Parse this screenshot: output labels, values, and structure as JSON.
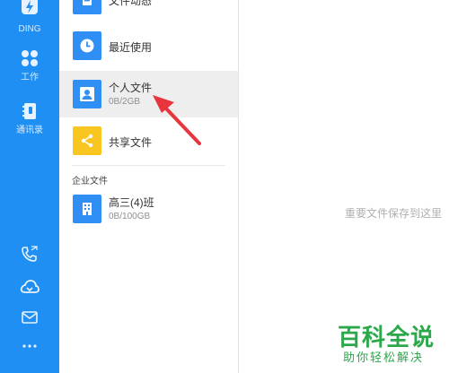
{
  "sidebar": {
    "items": [
      {
        "label": "DING",
        "icon": "ding-bolt-icon"
      },
      {
        "label": "工作",
        "icon": "work-grid-icon"
      },
      {
        "label": "通讯录",
        "icon": "contacts-book-icon"
      }
    ],
    "bottom_icons": [
      "phone-icon",
      "cloud-icon",
      "mail-icon",
      "more-dots-icon"
    ]
  },
  "files": {
    "top_partial": {
      "label": "文件动态"
    },
    "items": [
      {
        "label": "最近使用",
        "icon": "clock-icon",
        "color": "#2f8ff4"
      },
      {
        "label": "个人文件",
        "size": "0B/2GB",
        "icon": "person-icon",
        "color": "#2f8ff4"
      },
      {
        "label": "共享文件",
        "icon": "share-icon",
        "color": "#f8c521"
      }
    ],
    "section_title": "企业文件",
    "enterprise": [
      {
        "label": "高三(4)班",
        "size": "0B/100GB",
        "icon": "building-icon",
        "color": "#2f8ff4"
      }
    ]
  },
  "main": {
    "empty_hint": "重要文件保存到这里"
  },
  "watermark": {
    "title": "百科全说",
    "subtitle": "助你轻松解决"
  },
  "colors": {
    "rail": "#1f8ff3",
    "accent": "#2f8ff4",
    "share": "#f8c521",
    "arrow": "#e8343c",
    "watermark": "#2ba84a"
  }
}
